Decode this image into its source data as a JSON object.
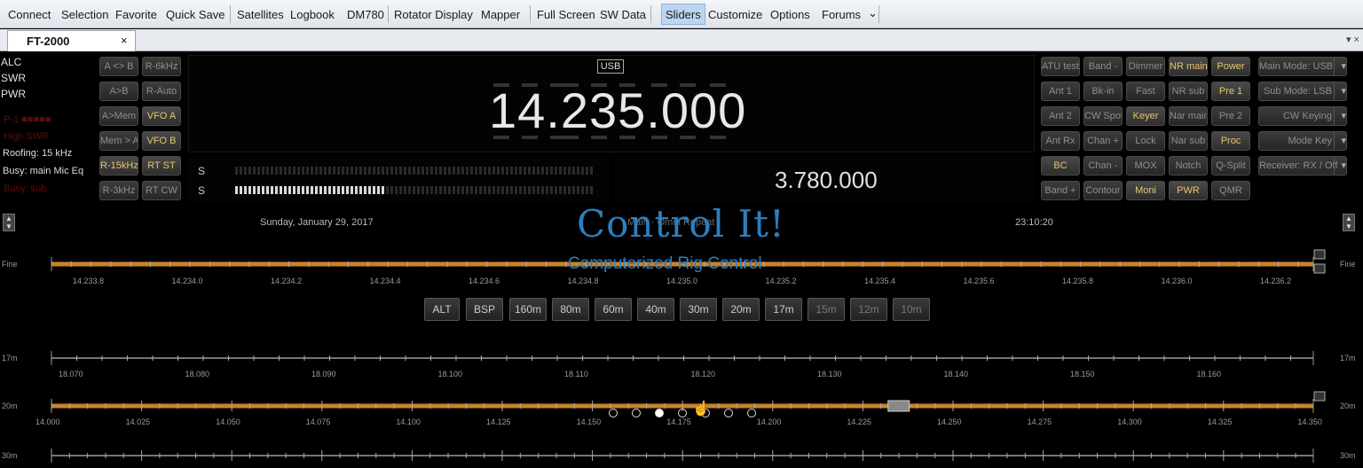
{
  "toolbar": {
    "items": [
      "Connect",
      "Selection",
      "Favorite",
      "Quick Save",
      "Satellites",
      "Logbook",
      "DM780",
      "Rotator Display",
      "Mapper",
      "Full Screen",
      "SW Data",
      "Sliders",
      "Customize",
      "Options",
      "Forums"
    ],
    "active": "Sliders",
    "overflow_glyph": "⌄"
  },
  "tab": {
    "label": "FT-2000",
    "close": "×",
    "controls": "▾ ×"
  },
  "meters": {
    "alc": "ALC",
    "swr": "SWR",
    "pwr": "PWR",
    "dim1": "P-1 ■■■■■",
    "dim2": "High SWR"
  },
  "status": {
    "roofing": "Roofing: 15 kHz",
    "busy": "Busy: main Mic Eq",
    "dim3": "Busy: sub"
  },
  "left_buttons": [
    [
      "A <> B",
      "R-6kHz"
    ],
    [
      "A>B",
      "R-Auto"
    ],
    [
      "A>Mem",
      "VFO A"
    ],
    [
      "Mem > A",
      "VFO B"
    ],
    [
      "R-15kHz",
      "RT ST"
    ],
    [
      "R-3kHz",
      "RT CW"
    ]
  ],
  "main": {
    "mode": "USB",
    "freq_a": "14.235.000",
    "freq_b": "3.780.000",
    "s1": "S",
    "s2": "S"
  },
  "right_grid": [
    [
      "ATU test",
      "Band -",
      "Dimmer",
      "NR main",
      "Power"
    ],
    [
      "Ant 1",
      "Bk-in",
      "Fast",
      "NR sub",
      "Pre 1"
    ],
    [
      "Ant 2",
      "CW Spot",
      "Keyer",
      "Nar main",
      "Pre 2"
    ],
    [
      "Ant Rx",
      "Chan +",
      "Lock",
      "Nar sub",
      "Proc"
    ],
    [
      "BC",
      "Chan -",
      "MOX",
      "Notch",
      "Q-Split"
    ],
    [
      "Band +",
      "Contour",
      "Moni",
      "PWR",
      "QMR"
    ]
  ],
  "right_wide": [
    "Main Mode: USB",
    "Sub Mode: LSB",
    "CW Keying",
    "Mode Key",
    "Receiver: RX / Off"
  ],
  "header": {
    "date": "Sunday, January 29, 2017",
    "center": "Main · Omni Repeat",
    "time": "23:10:20"
  },
  "overlay": {
    "title": "Control It!",
    "subtitle": "Computerized Rig Control"
  },
  "side_labels": {
    "fine": "Fine",
    "b17": "17m",
    "b20": "20m",
    "b30": "30m"
  },
  "bands": [
    "ALT",
    "BSP",
    "160m",
    "80m",
    "60m",
    "40m",
    "30m",
    "20m",
    "17m",
    "15m",
    "12m",
    "10m"
  ],
  "bands_dim": [
    "15m",
    "12m",
    "10m"
  ],
  "fine_ticks": [
    "14.233.8",
    "14.234.0",
    "14.234.2",
    "14.234.4",
    "14.234.6",
    "14.234.8",
    "14.235.0",
    "14.235.2",
    "14.235.4",
    "14.235.6",
    "14.235.8",
    "14.236.0",
    "14.236.2"
  ],
  "ticks_17m": [
    "18.070",
    "18.080",
    "18.090",
    "18.100",
    "18.110",
    "18.120",
    "18.130",
    "18.140",
    "18.150",
    "18.160"
  ],
  "ticks_20m": [
    "14.000",
    "14.025",
    "14.050",
    "14.075",
    "14.100",
    "14.125",
    "14.150",
    "14.175",
    "14.200",
    "14.225",
    "14.250",
    "14.275",
    "14.300",
    "14.325",
    "14.350"
  ],
  "slider_20m_value": 14.235,
  "carousel": {
    "count": 7,
    "active": 2
  },
  "colors": {
    "accent": "#e8c56b",
    "slider": "#c8822e",
    "overlay": "#2d7fbd"
  }
}
